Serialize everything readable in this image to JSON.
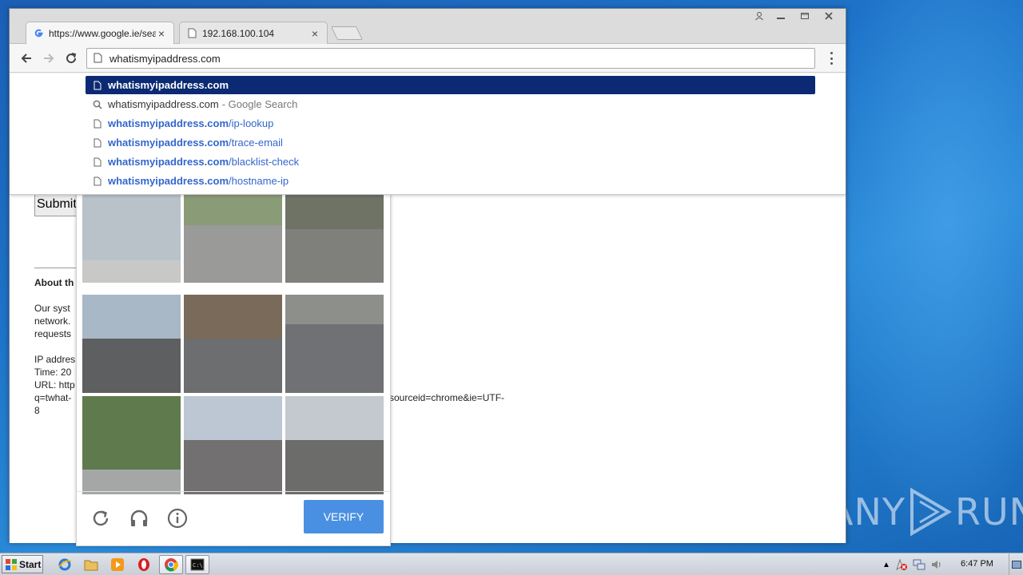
{
  "browser": {
    "tabs": [
      {
        "label": "https://www.google.ie/sear",
        "active": true
      },
      {
        "label": "192.168.100.104",
        "active": false
      }
    ],
    "omnibox_value": "whatismyipaddress.com",
    "suggestions": [
      {
        "icon": "page-icon",
        "bold": "whatismyipaddress.com",
        "rest": "",
        "suffix": "",
        "selected": true
      },
      {
        "icon": "search-icon",
        "plain": "whatismyipaddress.com",
        "suffix": "- Google Search",
        "selected": false
      },
      {
        "icon": "page-icon",
        "bold": "whatismyipaddress.com",
        "rest": "/ip-lookup",
        "selected": false
      },
      {
        "icon": "page-icon",
        "bold": "whatismyipaddress.com",
        "rest": "/trace-email",
        "selected": false
      },
      {
        "icon": "page-icon",
        "bold": "whatismyipaddress.com",
        "rest": "/blacklist-check",
        "selected": false
      },
      {
        "icon": "page-icon",
        "bold": "whatismyipaddress.com",
        "rest": "/hostname-ip",
        "selected": false
      }
    ]
  },
  "page": {
    "submit_label": "Submit",
    "about_heading": "About th",
    "para_lines": [
      "Our syst",
      "network.",
      "requests"
    ],
    "ip_lines": [
      "IP addres",
      "Time: 20",
      "URL: http"
    ],
    "url_line": "q=twhat-",
    "url_tail": "sourceid=chrome&ie=UTF-",
    "url_end": "8"
  },
  "captcha": {
    "verify_label": "VERIFY",
    "tiles": [
      "lakeshore",
      "highway-cars",
      "motorcycle",
      "city-street",
      "crosswalk-1",
      "crosswalk-2",
      "trees-parked-cars",
      "residential-street",
      "highway-car"
    ]
  },
  "taskbar": {
    "start_label": "Start",
    "clock": "6:47 PM"
  },
  "watermark": {
    "left": "ANY",
    "right": "RUN"
  },
  "colors": {
    "selected_suggestion": "#0c2a73",
    "verify_button": "#4a90e2",
    "link_blue": "#3366cc"
  }
}
